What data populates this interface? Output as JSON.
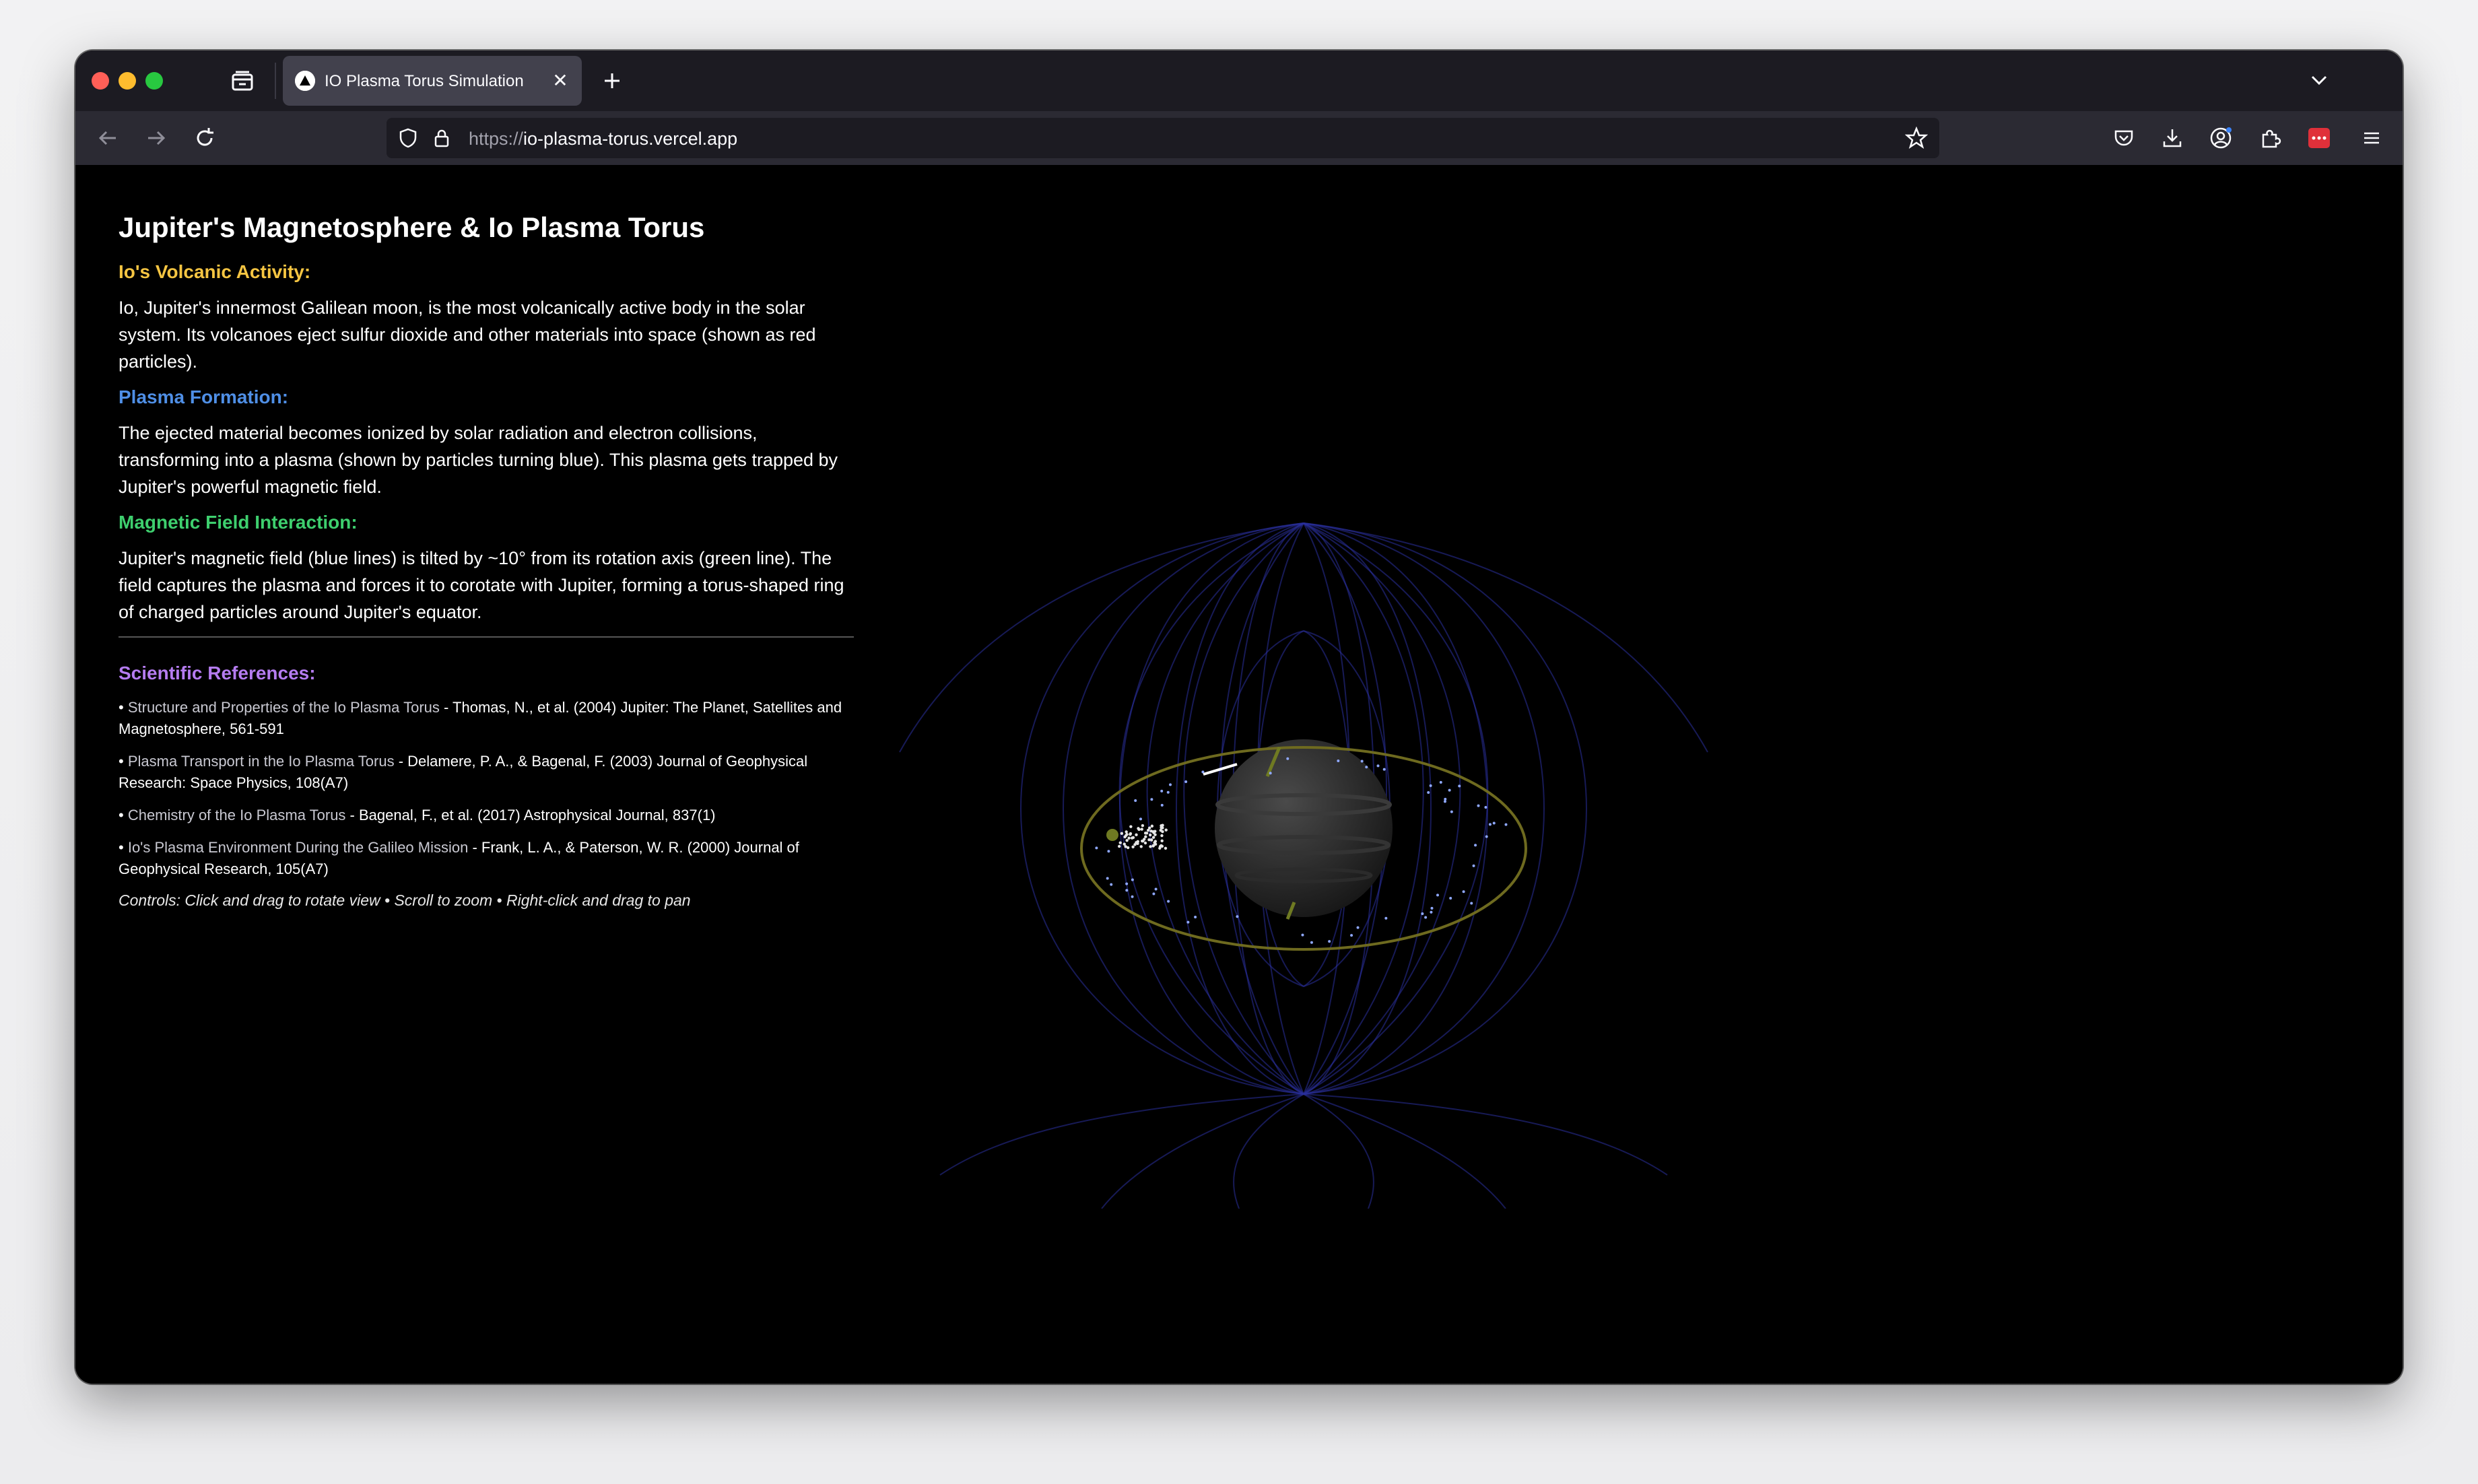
{
  "browser": {
    "tab_title": "IO Plasma Torus Simulation",
    "tab_close": "✕",
    "url_scheme": "https://",
    "url_host": "io-plasma-torus.vercel.app"
  },
  "page": {
    "title": "Jupiter's Magnetosphere & Io Plasma Torus",
    "sections": [
      {
        "heading": "Io's Volcanic Activity:",
        "color": "#f5c542",
        "text": "Io, Jupiter's innermost Galilean moon, is the most volcanically active body in the solar system. Its volcanoes eject sulfur dioxide and other materials into space (shown as red particles)."
      },
      {
        "heading": "Plasma Formation:",
        "color": "#4f8fe6",
        "text": "The ejected material becomes ionized by solar radiation and electron collisions, transforming into a plasma (shown by particles turning blue). This plasma gets trapped by Jupiter's powerful magnetic field."
      },
      {
        "heading": "Magnetic Field Interaction:",
        "color": "#3ecf6e",
        "text": "Jupiter's magnetic field (blue lines) is tilted by ~10° from its rotation axis (green line). The field captures the plasma and forces it to corotate with Jupiter, forming a torus-shaped ring of charged particles around Jupiter's equator."
      }
    ],
    "references_heading": "Scientific References:",
    "references_color": "#b57cf0",
    "references": [
      {
        "bullet": "•",
        "title": "Structure and Properties of the Io Plasma Torus",
        "detail": " - Thomas, N., et al. (2004) Jupiter: The Planet, Satellites and Magnetosphere, 561-591"
      },
      {
        "bullet": "•",
        "title": "Plasma Transport in the Io Plasma Torus",
        "detail": " - Delamere, P. A., & Bagenal, F. (2003) Journal of Geophysical Research: Space Physics, 108(A7)"
      },
      {
        "bullet": "•",
        "title": "Chemistry of the Io Plasma Torus",
        "detail": " - Bagenal, F., et al. (2017) Astrophysical Journal, 837(1)"
      },
      {
        "bullet": "•",
        "title": "Io's Plasma Environment During the Galileo Mission",
        "detail": " - Frank, L. A., & Paterson, W. R. (2000) Journal of Geophysical Research, 105(A7)"
      }
    ],
    "controls": "Controls: Click and drag to rotate view • Scroll to zoom • Right-click and drag to pan"
  }
}
